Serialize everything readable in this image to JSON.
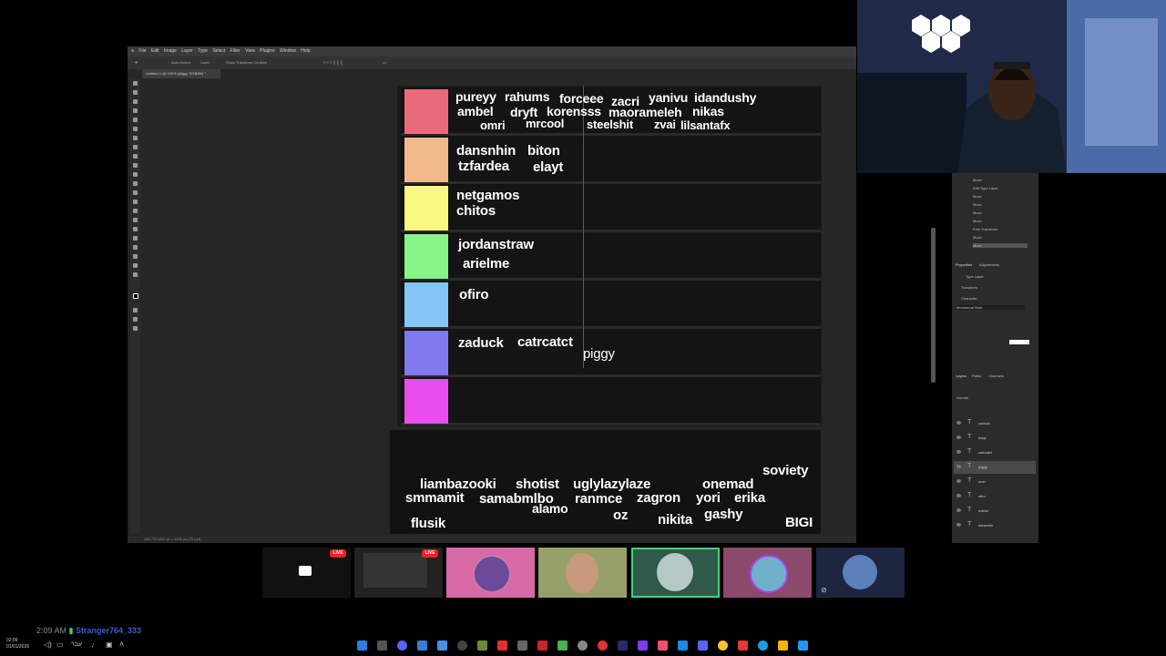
{
  "photoshop": {
    "menu": [
      "File",
      "Edit",
      "Image",
      "Layer",
      "Type",
      "Select",
      "Filter",
      "View",
      "Plugins",
      "Window",
      "Help"
    ],
    "options_auto_select": "Auto-Select",
    "options_layer": "Layer",
    "options_transform": "Show Transform Controls",
    "doc_tab": "Untitled-1 @ 100% (piggy, RGB/8#) *",
    "status": "100.7%    1600 px x 1600 px (72 ppi)"
  },
  "panels": {
    "history_items": [
      "Move",
      "Edit Type Layer",
      "Move",
      "Move",
      "Move",
      "Move",
      "Free Transform",
      "Move",
      "Move"
    ],
    "properties_tab": "Properties",
    "adjustments_tab": "Adjustments",
    "type_layer": "Type Layer",
    "transform": "Transform",
    "character": "Character",
    "font": "Montserrat Bold",
    "layers_tab": "Layers",
    "channels_tab": "Channels",
    "paths_tab": "Paths",
    "blend_mode": "Normal",
    "layers": [
      "zaduck",
      "elayt",
      "catrcatct",
      "piggy",
      "omri",
      "ofiro",
      "fusbal",
      "dansnhin"
    ]
  },
  "tiers": [
    {
      "color": "#ea6a7d",
      "names": [
        "pureyy",
        "rahums",
        "forceee",
        "zacri",
        "yanivu",
        "idandushy",
        "ambel",
        "dryft",
        "korensss",
        "maorameleh",
        "nikas",
        "omri",
        "mrcool",
        "steelshit",
        "zvai",
        "lilsantafx"
      ]
    },
    {
      "color": "#f2b98a",
      "names": [
        "dansnhin",
        "biton",
        "tzfardea",
        "elayt"
      ]
    },
    {
      "color": "#f7f981",
      "names": [
        "netgamos",
        "chitos"
      ]
    },
    {
      "color": "#86f486",
      "names": [
        "jordanstraw",
        "arielme"
      ]
    },
    {
      "color": "#86c5f7",
      "names": [
        "ofiro"
      ]
    },
    {
      "color": "#7f79ed",
      "names": [
        "zaduck",
        "catrcatct",
        "piggy"
      ]
    },
    {
      "color": "#ea4ded",
      "names": []
    }
  ],
  "unranked": [
    "soviety",
    "liambazooki",
    "shotist",
    "uglylazylaze",
    "onemad",
    "smmamit",
    "samabmlbo",
    "ranmce",
    "zagron",
    "yori",
    "erika",
    "alamo",
    "flusik",
    "oz",
    "nikita",
    "gashy",
    "BIGI"
  ],
  "taskbar_thumbs": {
    "live": "LIVE"
  },
  "chat": {
    "time": "2:09 AM",
    "user": "Stranger764_333"
  },
  "clock": {
    "time": "02:09",
    "date": "01/01/2026"
  },
  "lang": "עבר"
}
